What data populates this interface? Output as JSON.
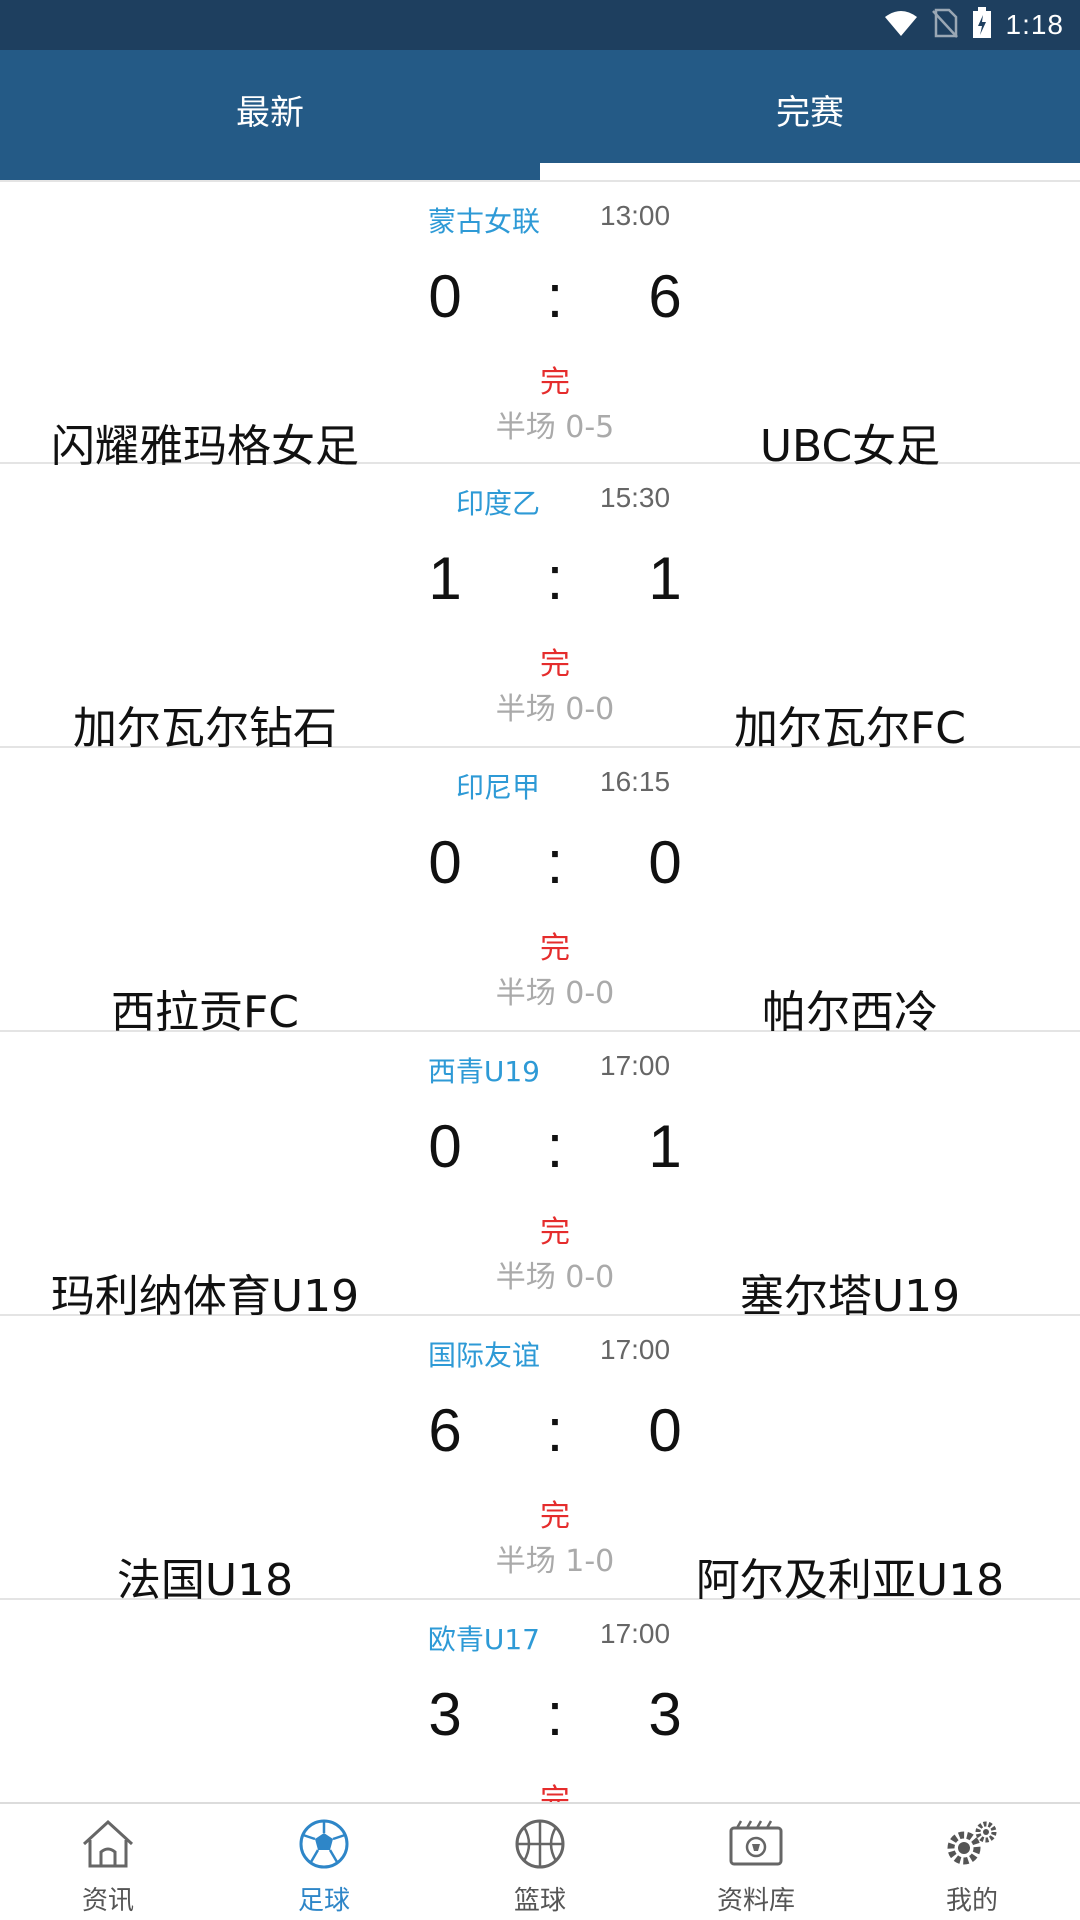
{
  "status_bar": {
    "time": "1:18"
  },
  "tabs": [
    {
      "label": "最新",
      "active": false
    },
    {
      "label": "完赛",
      "active": true
    }
  ],
  "matches": [
    {
      "league": "蒙古女联",
      "time": "13:00",
      "home_score": "0",
      "away_score": "6",
      "separator": ":",
      "status": "完",
      "half": "半场  0-5",
      "home": "闪耀雅玛格女足",
      "away": "UBC女足"
    },
    {
      "league": "印度乙",
      "time": "15:30",
      "home_score": "1",
      "away_score": "1",
      "separator": ":",
      "status": "完",
      "half": "半场  0-0",
      "home": "加尔瓦尔钻石",
      "away": "加尔瓦尔FC"
    },
    {
      "league": "印尼甲",
      "time": "16:15",
      "home_score": "0",
      "away_score": "0",
      "separator": ":",
      "status": "完",
      "half": "半场  0-0",
      "home": "西拉贡FC",
      "away": "帕尔西冷"
    },
    {
      "league": "西青U19",
      "time": "17:00",
      "home_score": "0",
      "away_score": "1",
      "separator": ":",
      "status": "完",
      "half": "半场  0-0",
      "home": "玛利纳体育U19",
      "away": "塞尔塔U19"
    },
    {
      "league": "国际友谊",
      "time": "17:00",
      "home_score": "6",
      "away_score": "0",
      "separator": ":",
      "status": "完",
      "half": "半场  1-0",
      "home": "法国U18",
      "away": "阿尔及利亚U18"
    },
    {
      "league": "欧青U17",
      "time": "17:00",
      "home_score": "3",
      "away_score": "3",
      "separator": ":",
      "status": "完",
      "half": "",
      "home": "",
      "away": ""
    }
  ],
  "nav": [
    {
      "label": "资讯",
      "icon": "home-icon",
      "active": false
    },
    {
      "label": "足球",
      "icon": "soccer-ball-icon",
      "active": true
    },
    {
      "label": "篮球",
      "icon": "basketball-icon",
      "active": false
    },
    {
      "label": "资料库",
      "icon": "database-icon",
      "active": false
    },
    {
      "label": "我的",
      "icon": "gear-icon",
      "active": false
    }
  ],
  "colors": {
    "status_bar": "#1e3f5f",
    "tab_bar": "#245a86",
    "league": "#2e9ad6",
    "finished": "#e52c2c",
    "nav_active": "#2e86c8"
  }
}
